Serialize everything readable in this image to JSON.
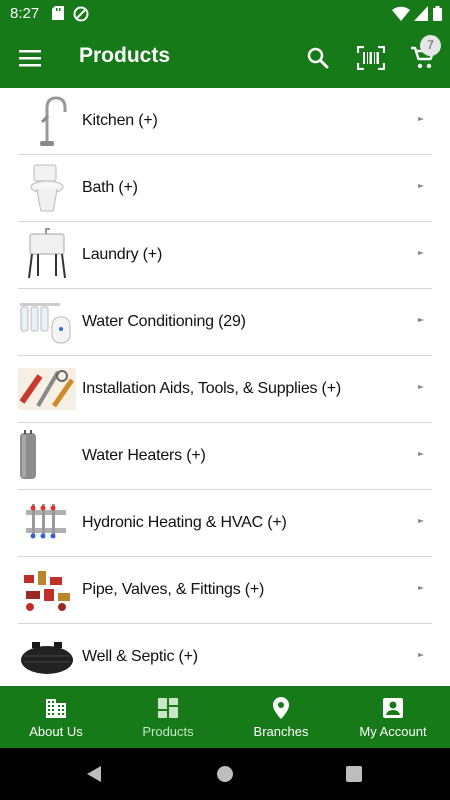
{
  "status": {
    "time": "8:27"
  },
  "appbar": {
    "title": "Products",
    "cart_count": "7"
  },
  "products": [
    {
      "label": "Kitchen (+)",
      "thumb": "faucet"
    },
    {
      "label": "Bath (+)",
      "thumb": "toilet"
    },
    {
      "label": "Laundry (+)",
      "thumb": "laundry-tub"
    },
    {
      "label": "Water Conditioning (29)",
      "thumb": "filter-system"
    },
    {
      "label": "Installation Aids, Tools, & Supplies (+)",
      "thumb": "tools"
    },
    {
      "label": "Water Heaters (+)",
      "thumb": "water-heater"
    },
    {
      "label": "Hydronic Heating & HVAC (+)",
      "thumb": "manifold"
    },
    {
      "label": "Pipe, Valves, & Fittings (+)",
      "thumb": "fittings"
    },
    {
      "label": "Well & Septic (+)",
      "thumb": "septic-tank"
    }
  ],
  "bottom_nav": [
    {
      "label": "About Us",
      "icon": "building-icon"
    },
    {
      "label": "Products",
      "icon": "grid-icon",
      "active": true
    },
    {
      "label": "Branches",
      "icon": "map-pin-icon"
    },
    {
      "label": "My Account",
      "icon": "account-icon"
    }
  ],
  "colors": {
    "primary": "#157a17",
    "divider": "#d4d4d4"
  }
}
